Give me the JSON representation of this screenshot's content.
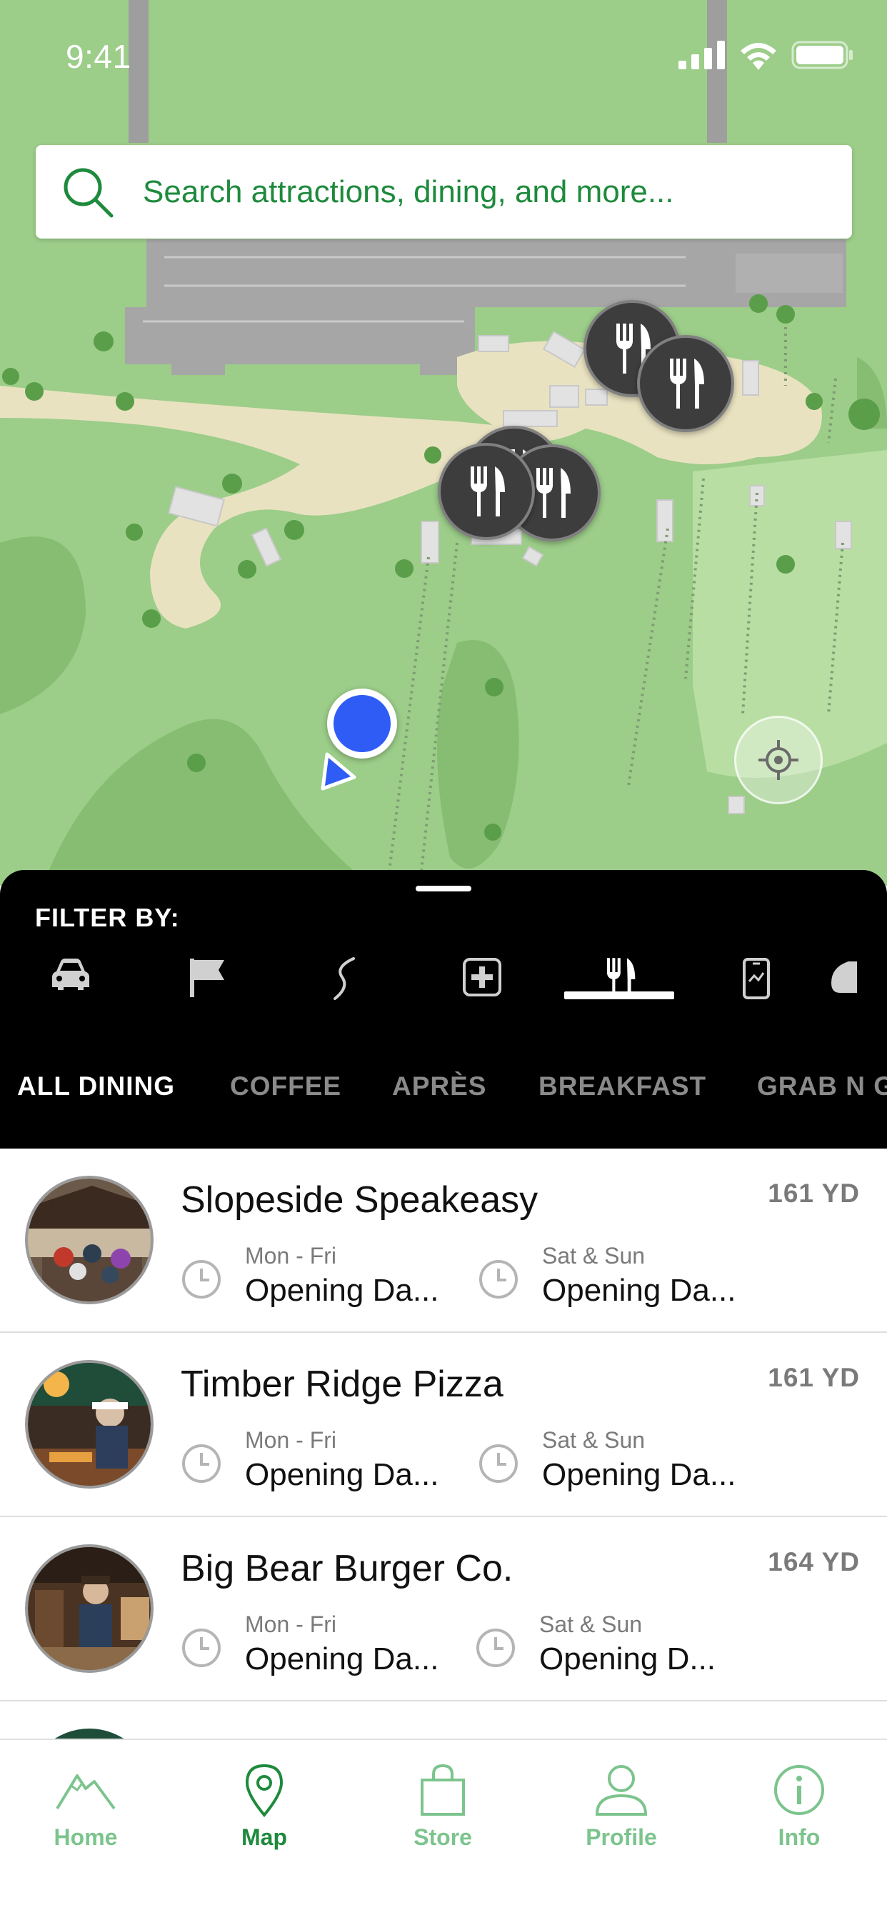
{
  "status_bar": {
    "time": "9:41"
  },
  "search": {
    "placeholder": "Search attractions, dining, and more..."
  },
  "map": {
    "pins": [
      {
        "icon": "fork-knife-icon"
      },
      {
        "icon": "fork-knife-icon"
      },
      {
        "icon": "fork-knife-icon"
      },
      {
        "icon": "fork-knife-icon"
      },
      {
        "icon": "fork-knife-icon"
      }
    ],
    "colors": {
      "grass": "#9ccd89",
      "path": "#e9e2c1",
      "user_dot": "#2f5cf5",
      "pin": "#3d3d3d"
    }
  },
  "filter": {
    "title": "FILTER BY:",
    "icons": [
      "car-icon",
      "flag-icon",
      "trail-icon",
      "first-aid-icon",
      "dining-icon",
      "phone-icon",
      "more-icon"
    ],
    "selected_icon": "dining-icon",
    "sub_tabs": [
      "ALL DINING",
      "COFFEE",
      "APRÈS",
      "BREAKFAST",
      "GRAB N G"
    ],
    "selected_sub_tab": "ALL DINING"
  },
  "list": {
    "items": [
      {
        "name": "Slopeside Speakeasy",
        "distance": "161 YD",
        "weekday_label": "Mon - Fri",
        "weekday_value": "Opening Da...",
        "weekend_label": "Sat & Sun",
        "weekend_value": "Opening Da..."
      },
      {
        "name": "Timber Ridge Pizza",
        "distance": "161 YD",
        "weekday_label": "Mon - Fri",
        "weekday_value": "Opening Da...",
        "weekend_label": "Sat & Sun",
        "weekend_value": "Opening Da..."
      },
      {
        "name": "Big Bear Burger Co.",
        "distance": "164 YD",
        "weekday_label": "Mon - Fri",
        "weekday_value": "Opening Da...",
        "weekend_label": "Sat & Sun",
        "weekend_value": "Opening D..."
      }
    ]
  },
  "tab_bar": {
    "tabs": [
      {
        "label": "Home",
        "icon": "mountain-icon"
      },
      {
        "label": "Map",
        "icon": "map-pin-icon"
      },
      {
        "label": "Store",
        "icon": "shopping-bag-icon"
      },
      {
        "label": "Profile",
        "icon": "person-icon"
      },
      {
        "label": "Info",
        "icon": "info-icon"
      }
    ],
    "active": "Map",
    "colors": {
      "active": "#1e8a3c",
      "inactive": "#7cc48d"
    }
  }
}
